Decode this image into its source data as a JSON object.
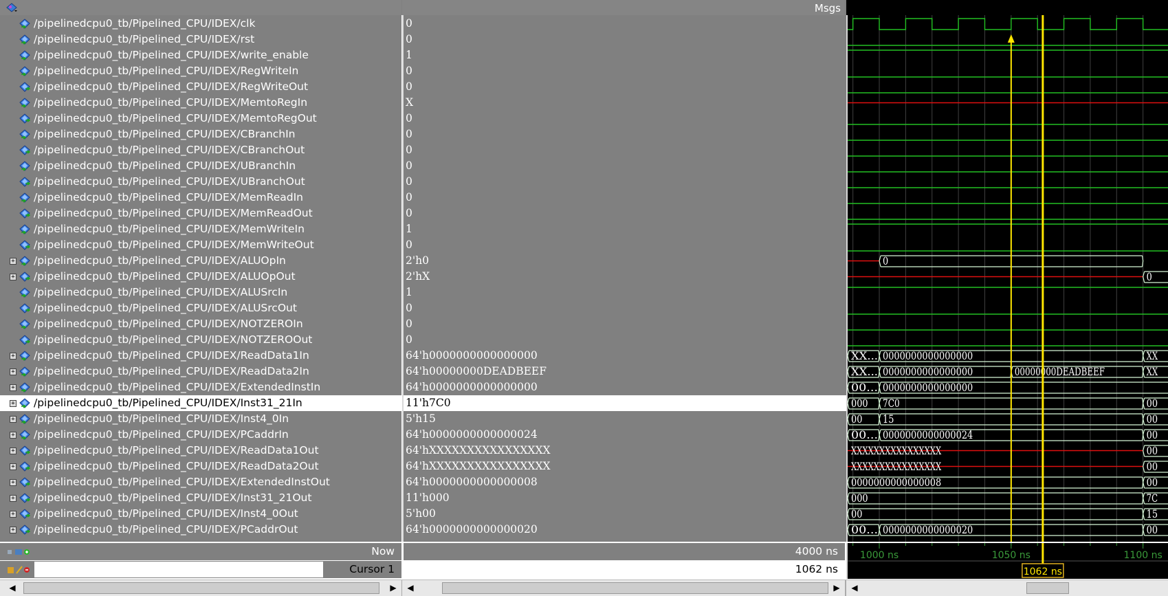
{
  "header": {
    "msgs_label": "Msgs"
  },
  "signals": [
    {
      "name": "/pipelinedcpu0_tb/Pipelined_CPU/IDEX/clk",
      "value": "0",
      "expandable": false,
      "kind": "input"
    },
    {
      "name": "/pipelinedcpu0_tb/Pipelined_CPU/IDEX/rst",
      "value": "0",
      "expandable": false,
      "kind": "input"
    },
    {
      "name": "/pipelinedcpu0_tb/Pipelined_CPU/IDEX/write_enable",
      "value": "1",
      "expandable": false,
      "kind": "input"
    },
    {
      "name": "/pipelinedcpu0_tb/Pipelined_CPU/IDEX/RegWriteIn",
      "value": "0",
      "expandable": false,
      "kind": "input"
    },
    {
      "name": "/pipelinedcpu0_tb/Pipelined_CPU/IDEX/RegWriteOut",
      "value": "0",
      "expandable": false,
      "kind": "output"
    },
    {
      "name": "/pipelinedcpu0_tb/Pipelined_CPU/IDEX/MemtoRegIn",
      "value": "X",
      "expandable": false,
      "kind": "input"
    },
    {
      "name": "/pipelinedcpu0_tb/Pipelined_CPU/IDEX/MemtoRegOut",
      "value": "0",
      "expandable": false,
      "kind": "output"
    },
    {
      "name": "/pipelinedcpu0_tb/Pipelined_CPU/IDEX/CBranchIn",
      "value": "0",
      "expandable": false,
      "kind": "input"
    },
    {
      "name": "/pipelinedcpu0_tb/Pipelined_CPU/IDEX/CBranchOut",
      "value": "0",
      "expandable": false,
      "kind": "output"
    },
    {
      "name": "/pipelinedcpu0_tb/Pipelined_CPU/IDEX/UBranchIn",
      "value": "0",
      "expandable": false,
      "kind": "input"
    },
    {
      "name": "/pipelinedcpu0_tb/Pipelined_CPU/IDEX/UBranchOut",
      "value": "0",
      "expandable": false,
      "kind": "output"
    },
    {
      "name": "/pipelinedcpu0_tb/Pipelined_CPU/IDEX/MemReadIn",
      "value": "0",
      "expandable": false,
      "kind": "input"
    },
    {
      "name": "/pipelinedcpu0_tb/Pipelined_CPU/IDEX/MemReadOut",
      "value": "0",
      "expandable": false,
      "kind": "output"
    },
    {
      "name": "/pipelinedcpu0_tb/Pipelined_CPU/IDEX/MemWriteIn",
      "value": "1",
      "expandable": false,
      "kind": "input"
    },
    {
      "name": "/pipelinedcpu0_tb/Pipelined_CPU/IDEX/MemWriteOut",
      "value": "0",
      "expandable": false,
      "kind": "output"
    },
    {
      "name": "/pipelinedcpu0_tb/Pipelined_CPU/IDEX/ALUOpIn",
      "value": "2'h0",
      "expandable": true,
      "kind": "input"
    },
    {
      "name": "/pipelinedcpu0_tb/Pipelined_CPU/IDEX/ALUOpOut",
      "value": "2'hX",
      "expandable": true,
      "kind": "output"
    },
    {
      "name": "/pipelinedcpu0_tb/Pipelined_CPU/IDEX/ALUSrcIn",
      "value": "1",
      "expandable": false,
      "kind": "input"
    },
    {
      "name": "/pipelinedcpu0_tb/Pipelined_CPU/IDEX/ALUSrcOut",
      "value": "0",
      "expandable": false,
      "kind": "output"
    },
    {
      "name": "/pipelinedcpu0_tb/Pipelined_CPU/IDEX/NOTZEROIn",
      "value": "0",
      "expandable": false,
      "kind": "input"
    },
    {
      "name": "/pipelinedcpu0_tb/Pipelined_CPU/IDEX/NOTZEROOut",
      "value": "0",
      "expandable": false,
      "kind": "output"
    },
    {
      "name": "/pipelinedcpu0_tb/Pipelined_CPU/IDEX/ReadData1In",
      "value": "64'h0000000000000000",
      "expandable": true,
      "kind": "input"
    },
    {
      "name": "/pipelinedcpu0_tb/Pipelined_CPU/IDEX/ReadData2In",
      "value": "64'h00000000DEADBEEF",
      "expandable": true,
      "kind": "input"
    },
    {
      "name": "/pipelinedcpu0_tb/Pipelined_CPU/IDEX/ExtendedInstIn",
      "value": "64'h0000000000000000",
      "expandable": true,
      "kind": "input"
    },
    {
      "name": "/pipelinedcpu0_tb/Pipelined_CPU/IDEX/Inst31_21In",
      "value": "11'h7C0",
      "expandable": true,
      "kind": "input",
      "selected": true
    },
    {
      "name": "/pipelinedcpu0_tb/Pipelined_CPU/IDEX/Inst4_0In",
      "value": "5'h15",
      "expandable": true,
      "kind": "input"
    },
    {
      "name": "/pipelinedcpu0_tb/Pipelined_CPU/IDEX/PCaddrIn",
      "value": "64'h0000000000000024",
      "expandable": true,
      "kind": "input"
    },
    {
      "name": "/pipelinedcpu0_tb/Pipelined_CPU/IDEX/ReadData1Out",
      "value": "64'hXXXXXXXXXXXXXXXX",
      "expandable": true,
      "kind": "output"
    },
    {
      "name": "/pipelinedcpu0_tb/Pipelined_CPU/IDEX/ReadData2Out",
      "value": "64'hXXXXXXXXXXXXXXXX",
      "expandable": true,
      "kind": "output"
    },
    {
      "name": "/pipelinedcpu0_tb/Pipelined_CPU/IDEX/ExtendedInstOut",
      "value": "64'h0000000000000008",
      "expandable": true,
      "kind": "output"
    },
    {
      "name": "/pipelinedcpu0_tb/Pipelined_CPU/IDEX/Inst31_21Out",
      "value": "11'h000",
      "expandable": true,
      "kind": "output"
    },
    {
      "name": "/pipelinedcpu0_tb/Pipelined_CPU/IDEX/Inst4_0Out",
      "value": "5'h00",
      "expandable": true,
      "kind": "output"
    },
    {
      "name": "/pipelinedcpu0_tb/Pipelined_CPU/IDEX/PCaddrOut",
      "value": "64'h0000000000000020",
      "expandable": true,
      "kind": "output"
    }
  ],
  "waves": [
    {
      "type": "clk"
    },
    {
      "type": "bit",
      "level": 0
    },
    {
      "type": "bit",
      "level": 1
    },
    {
      "type": "bit",
      "level": 0
    },
    {
      "type": "bit",
      "level": 0
    },
    {
      "type": "xbit"
    },
    {
      "type": "bit",
      "level": 0
    },
    {
      "type": "bit",
      "level": 0
    },
    {
      "type": "bit",
      "level": 0
    },
    {
      "type": "bit",
      "level": 0
    },
    {
      "type": "bit",
      "level": 0
    },
    {
      "type": "bit",
      "level": 0
    },
    {
      "type": "bit",
      "level": 0
    },
    {
      "type": "bit",
      "level": 1
    },
    {
      "type": "bit",
      "level": 0
    },
    {
      "type": "bus",
      "segments": [
        {
          "v": "",
          "x": true,
          "to": 1000
        },
        {
          "v": "0",
          "to": 1100
        }
      ]
    },
    {
      "type": "bus",
      "segments": [
        {
          "v": "",
          "x": true,
          "to": 1100
        },
        {
          "v": "0",
          "to": 1110
        }
      ]
    },
    {
      "type": "bit",
      "level": 1
    },
    {
      "type": "bit",
      "level": 0
    },
    {
      "type": "bit",
      "level": 0
    },
    {
      "type": "bit",
      "level": 0
    },
    {
      "type": "bus",
      "segments": [
        {
          "v": "XX...",
          "to": 1000
        },
        {
          "v": "0000000000000000",
          "to": 1100
        },
        {
          "v": "XX",
          "to": 1110
        }
      ]
    },
    {
      "type": "bus",
      "segments": [
        {
          "v": "XX...",
          "to": 1000
        },
        {
          "v": "0000000000000000",
          "to": 1050
        },
        {
          "v": "00000000DEADBEEF",
          "to": 1100
        },
        {
          "v": "XX",
          "to": 1110
        }
      ]
    },
    {
      "type": "bus",
      "segments": [
        {
          "v": "00...",
          "to": 1000
        },
        {
          "v": "0000000000000000",
          "to": 1110
        }
      ]
    },
    {
      "type": "bus",
      "segments": [
        {
          "v": "000",
          "to": 1000
        },
        {
          "v": "7C0",
          "to": 1100
        },
        {
          "v": "00",
          "to": 1110
        }
      ]
    },
    {
      "type": "bus",
      "segments": [
        {
          "v": "00",
          "to": 1000
        },
        {
          "v": "15",
          "to": 1100
        },
        {
          "v": "00",
          "to": 1110
        }
      ]
    },
    {
      "type": "bus",
      "segments": [
        {
          "v": "00...",
          "to": 1000
        },
        {
          "v": "0000000000000024",
          "to": 1100
        },
        {
          "v": "00",
          "to": 1110
        }
      ]
    },
    {
      "type": "bus",
      "segments": [
        {
          "v": "XXXXXXXXXXXXXXXX",
          "x": true,
          "to": 1100
        },
        {
          "v": "00",
          "to": 1110
        }
      ]
    },
    {
      "type": "bus",
      "segments": [
        {
          "v": "XXXXXXXXXXXXXXXX",
          "x": true,
          "to": 1100
        },
        {
          "v": "00",
          "to": 1110
        }
      ]
    },
    {
      "type": "bus",
      "segments": [
        {
          "v": "0000000000000008",
          "to": 1100
        },
        {
          "v": "00",
          "to": 1110
        }
      ]
    },
    {
      "type": "bus",
      "segments": [
        {
          "v": "000",
          "to": 1100
        },
        {
          "v": "7C",
          "to": 1110
        }
      ]
    },
    {
      "type": "bus",
      "segments": [
        {
          "v": "00",
          "to": 1100
        },
        {
          "v": "15",
          "to": 1110
        }
      ]
    },
    {
      "type": "bus",
      "segments": [
        {
          "v": "00...",
          "to": 1000
        },
        {
          "v": "0000000000000020",
          "to": 1100
        },
        {
          "v": "00",
          "to": 1110
        }
      ]
    }
  ],
  "time": {
    "view_start_ns": 988,
    "view_end_ns": 1110,
    "clk_period_ns": 20,
    "clk_falling_edge_ns": 1050,
    "marker_ns": 1050,
    "cursor_ns": 1062,
    "ticks": [
      {
        "label": "1000 ns",
        "t": 1000
      },
      {
        "label": "1050 ns",
        "t": 1050
      },
      {
        "label": "1100 ns",
        "t": 1100
      }
    ]
  },
  "footer": {
    "now_label": "Now",
    "now_value": "4000 ns",
    "cursor_label": "Cursor 1",
    "cursor_value": "1062 ns",
    "cursor_flag": "1062 ns"
  },
  "colors": {
    "wave_green": "#22c022",
    "wave_red": "#e01010",
    "bus_outline": "#d8f8d8",
    "cursor_yellow": "#ffe600",
    "grid": "#404040"
  }
}
